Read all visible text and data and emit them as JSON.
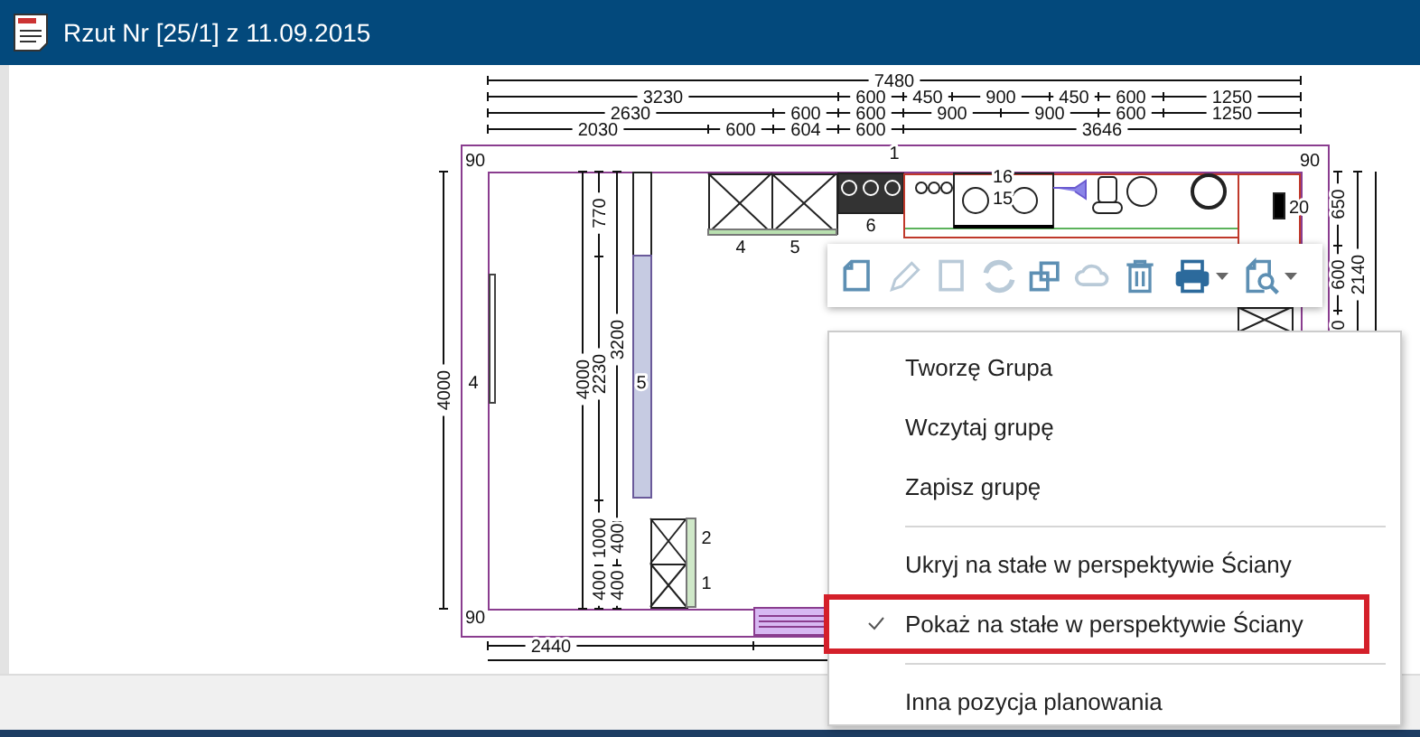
{
  "window": {
    "title": "Rzut Nr [25/1] z 11.09.2015"
  },
  "plan": {
    "top_dimensions": [
      [
        "7480"
      ],
      [
        "3230",
        "600",
        "450",
        "900",
        "450",
        "600",
        "1250"
      ],
      [
        "2630",
        "600",
        "600",
        "900",
        "900",
        "600",
        "1250"
      ],
      [
        "2030",
        "600",
        "604",
        "600",
        "3646"
      ]
    ],
    "left_dimensions": [
      [
        "4000"
      ],
      [
        "4000"
      ],
      [
        "770",
        "2230",
        "1000",
        "400"
      ],
      [
        "3200",
        "400",
        "400"
      ]
    ],
    "right_dimensions": [
      [
        "650",
        "600",
        "0"
      ],
      [
        "2140"
      ]
    ],
    "bottom_dimensions": [
      "2440"
    ],
    "labels": [
      "90",
      "1",
      "90",
      "16",
      "15",
      "20",
      "6",
      "4",
      "5",
      "4",
      "5",
      "2",
      "1",
      "90"
    ]
  },
  "toolbar": {
    "buttons": [
      {
        "kind": "new",
        "disabled": false,
        "dropdown": false
      },
      {
        "kind": "edit",
        "disabled": true,
        "dropdown": false
      },
      {
        "kind": "copy",
        "disabled": true,
        "dropdown": false
      },
      {
        "kind": "refresh",
        "disabled": true,
        "dropdown": false
      },
      {
        "kind": "duplicate",
        "disabled": false,
        "dropdown": false
      },
      {
        "kind": "cloud",
        "disabled": true,
        "dropdown": false
      },
      {
        "kind": "delete",
        "disabled": false,
        "dropdown": false
      },
      {
        "kind": "print",
        "disabled": false,
        "dropdown": true
      },
      {
        "kind": "preview",
        "disabled": false,
        "dropdown": true
      }
    ]
  },
  "context_menu": {
    "items": [
      {
        "kind": "item",
        "label": "Tworzę Grupa",
        "checked": false,
        "selected": false
      },
      {
        "kind": "item",
        "label": "Wczytaj grupę",
        "checked": false,
        "selected": false
      },
      {
        "kind": "item",
        "label": "Zapisz grupę",
        "checked": false,
        "selected": false
      },
      {
        "kind": "separator"
      },
      {
        "kind": "item",
        "label": "Ukryj na stałe w perspektywie Ściany",
        "checked": false,
        "selected": false
      },
      {
        "kind": "item",
        "label": "Pokaż na stałe w perspektywie Ściany",
        "checked": true,
        "selected": true
      },
      {
        "kind": "separator"
      },
      {
        "kind": "item",
        "label": "Inna pozycja planowania",
        "checked": false,
        "selected": false
      }
    ]
  }
}
